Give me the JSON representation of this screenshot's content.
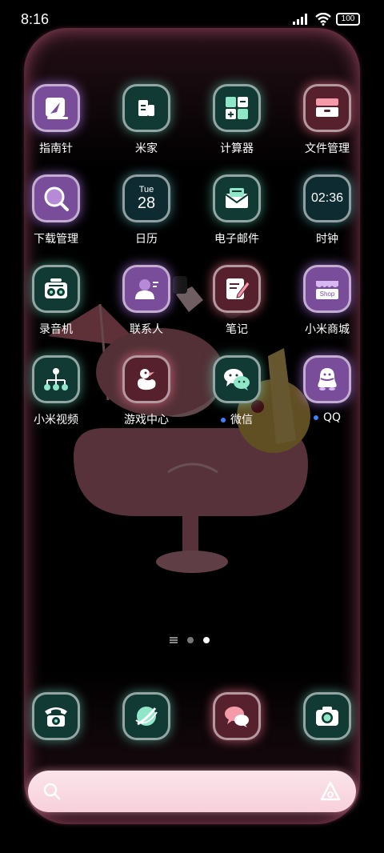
{
  "status_bar": {
    "time": "8:16",
    "battery": "100"
  },
  "apps": [
    {
      "id": "compass",
      "label": "指南针",
      "color": "purple"
    },
    {
      "id": "mijia",
      "label": "米家",
      "color": "teal"
    },
    {
      "id": "calculator",
      "label": "计算器",
      "color": "teal"
    },
    {
      "id": "file-manager",
      "label": "文件管理",
      "color": "pink"
    },
    {
      "id": "download-manager",
      "label": "下载管理",
      "color": "purple"
    },
    {
      "id": "calendar",
      "label": "日历",
      "color": "darkblue",
      "day": "Tue",
      "date": "28"
    },
    {
      "id": "email",
      "label": "电子邮件",
      "color": "teal"
    },
    {
      "id": "clock",
      "label": "时钟",
      "color": "darkblue",
      "time": "02:36"
    },
    {
      "id": "recorder",
      "label": "录音机",
      "color": "teal"
    },
    {
      "id": "contacts",
      "label": "联系人",
      "color": "purple"
    },
    {
      "id": "notes",
      "label": "笔记",
      "color": "pink"
    },
    {
      "id": "mi-store",
      "label": "小米商城",
      "color": "purple",
      "badge": "Shop"
    },
    {
      "id": "mi-video",
      "label": "小米视频",
      "color": "teal"
    },
    {
      "id": "game-center",
      "label": "游戏中心",
      "color": "pink"
    },
    {
      "id": "wechat",
      "label": "微信",
      "color": "teal",
      "new": true
    },
    {
      "id": "qq",
      "label": "QQ",
      "color": "purple",
      "new": true
    }
  ],
  "dock": [
    {
      "id": "phone",
      "color": "teal"
    },
    {
      "id": "browser",
      "color": "teal"
    },
    {
      "id": "messages",
      "color": "pink"
    },
    {
      "id": "camera",
      "color": "teal"
    }
  ],
  "page_indicator": {
    "pages": 2,
    "active": 2
  }
}
